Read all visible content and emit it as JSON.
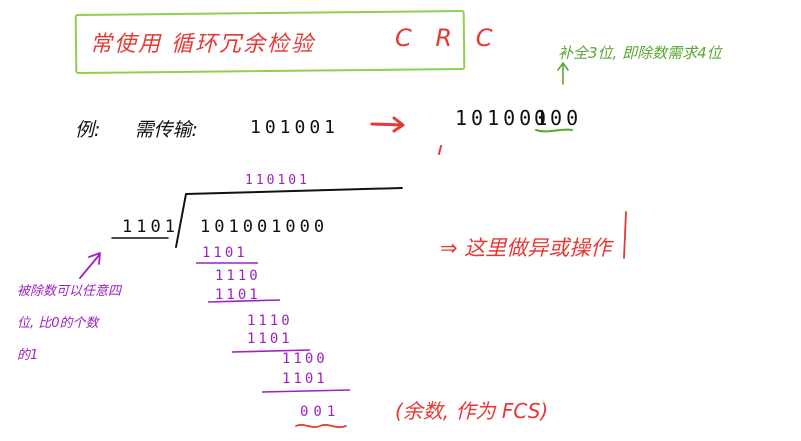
{
  "title": {
    "chinese": "常使用 循环冗余检验",
    "acronym": "C R C"
  },
  "notes": {
    "pad_hint": "补全3位, 即除数需求4位",
    "xor_hint": "⇒ 这里做异或操作",
    "remainder_hint": "(余数, 作为 FCS)",
    "divisor_hint_lines": [
      "被除数可以任意四",
      "位, 比0的个数",
      "的1"
    ]
  },
  "example": {
    "label": "例:",
    "need_transmit": "需传输:",
    "value": "101001",
    "padded_main": "101001",
    "padded_zeros": "000"
  },
  "division": {
    "divisor": "1101",
    "dividend": "101001000",
    "quotient": "110101",
    "steps": [
      "1101",
      "1110",
      "1101",
      "1110",
      "1101",
      "1100",
      "1101"
    ],
    "remainder": "001"
  },
  "colors": {
    "ink": "#111111",
    "red": "#e53935",
    "purple": "#a020c0",
    "green": "#5aa832",
    "title_box": "#8fd14f"
  }
}
